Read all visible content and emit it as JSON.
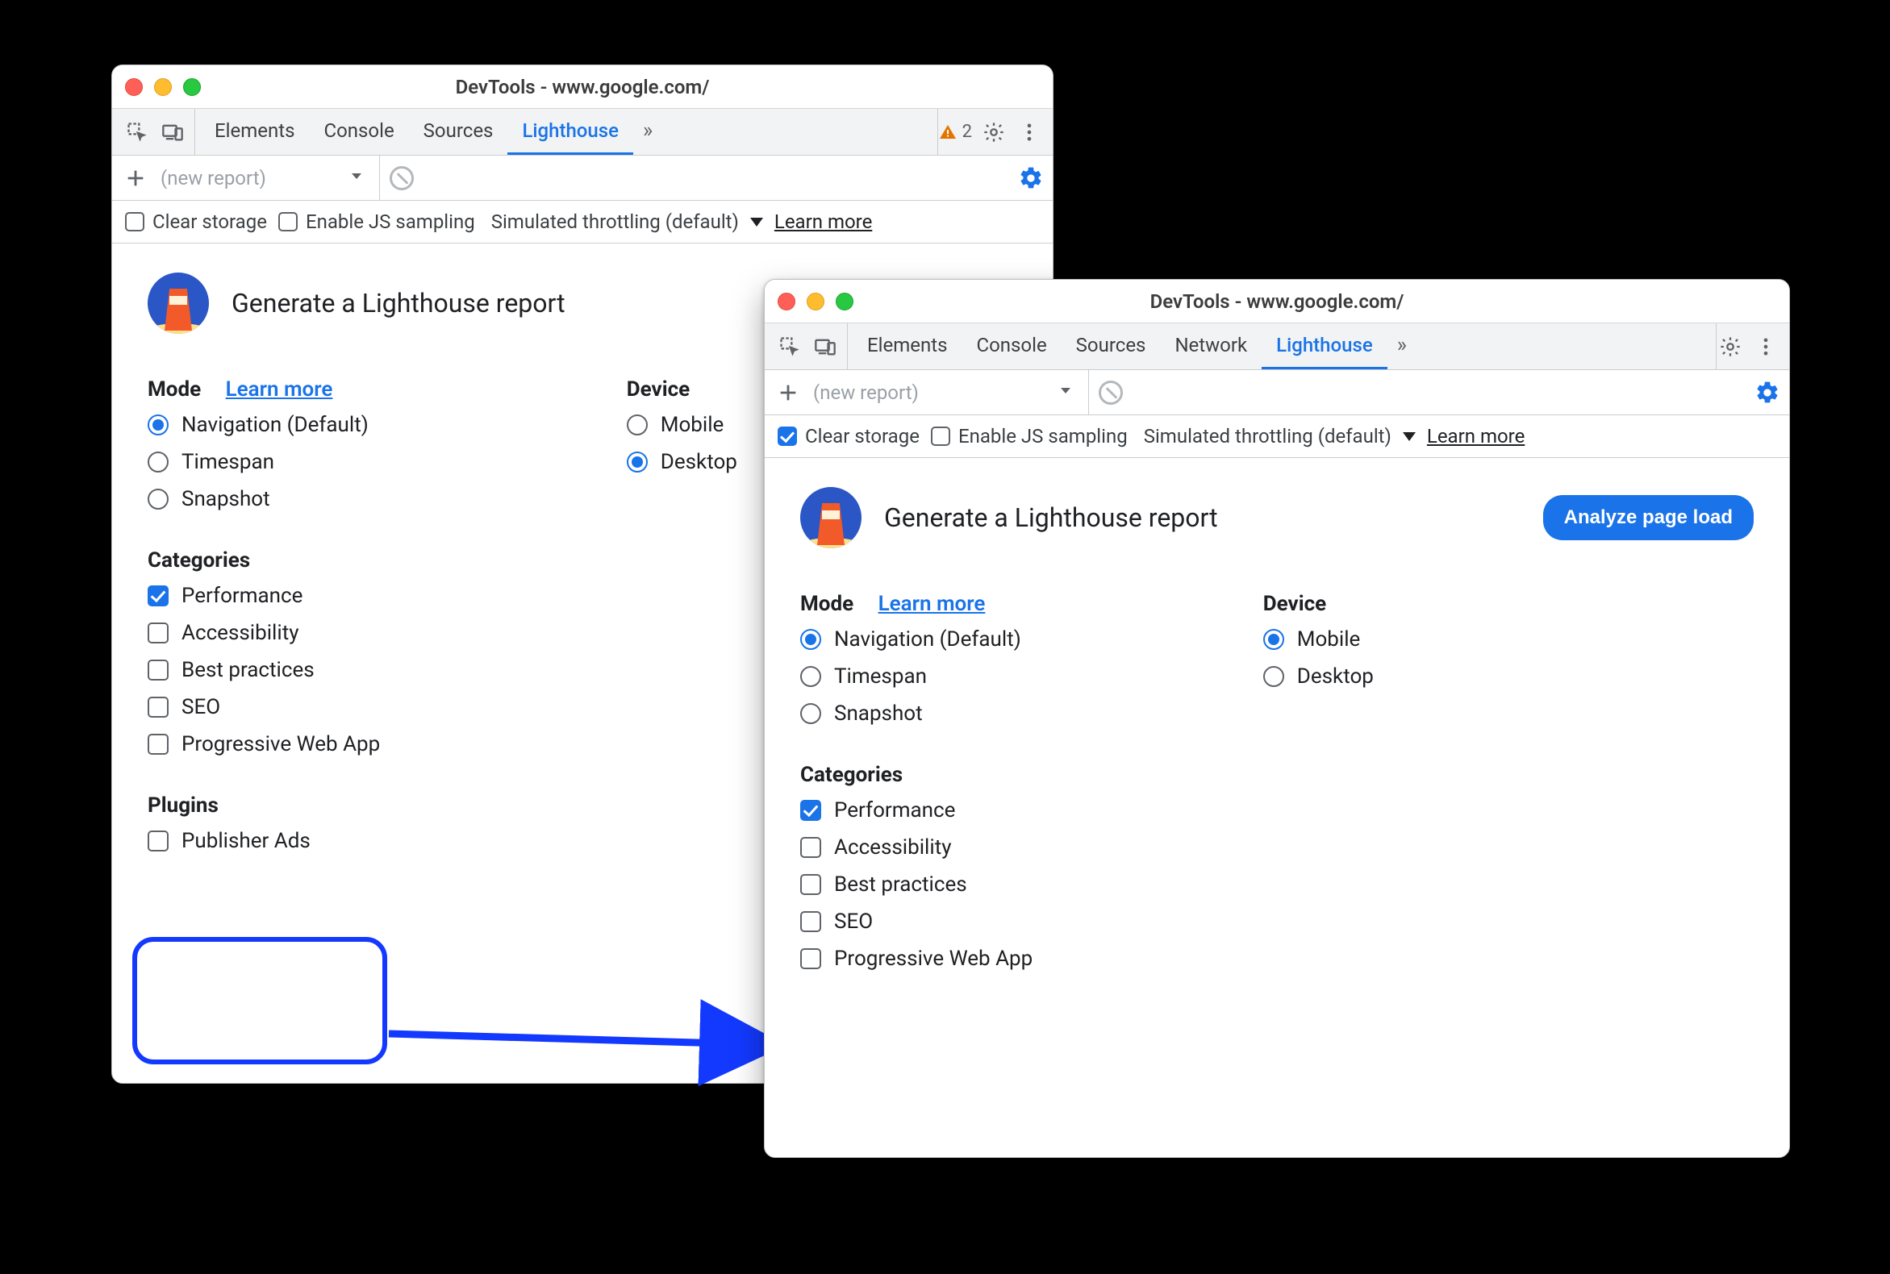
{
  "windowA": {
    "title": "DevTools - www.google.com/",
    "tabs": [
      "Elements",
      "Console",
      "Sources",
      "Lighthouse"
    ],
    "activeTab": "Lighthouse",
    "moreGlyph": "»",
    "warningCount": "2",
    "toolbar2": {
      "newReport": "(new report)",
      "clearStorage": {
        "label": "Clear storage",
        "checked": false
      },
      "enableJsSampling": {
        "label": "Enable JS sampling",
        "checked": false
      },
      "throttling": "Simulated throttling (default)",
      "learnMore": "Learn more"
    },
    "panel": {
      "heading": "Generate a Lighthouse report",
      "mode": {
        "title": "Mode",
        "learnMore": "Learn more",
        "options": [
          {
            "label": "Navigation (Default)",
            "selected": true
          },
          {
            "label": "Timespan",
            "selected": false
          },
          {
            "label": "Snapshot",
            "selected": false
          }
        ]
      },
      "device": {
        "title": "Device",
        "options": [
          {
            "label": "Mobile",
            "selected": false
          },
          {
            "label": "Desktop",
            "selected": true
          }
        ]
      },
      "categories": {
        "title": "Categories",
        "options": [
          {
            "label": "Performance",
            "selected": true
          },
          {
            "label": "Accessibility",
            "selected": false
          },
          {
            "label": "Best practices",
            "selected": false
          },
          {
            "label": "SEO",
            "selected": false
          },
          {
            "label": "Progressive Web App",
            "selected": false
          }
        ]
      },
      "plugins": {
        "title": "Plugins",
        "options": [
          {
            "label": "Publisher Ads",
            "selected": false
          }
        ]
      }
    }
  },
  "windowB": {
    "title": "DevTools - www.google.com/",
    "tabs": [
      "Elements",
      "Console",
      "Sources",
      "Network",
      "Lighthouse"
    ],
    "activeTab": "Lighthouse",
    "moreGlyph": "»",
    "toolbar2": {
      "newReport": "(new report)",
      "clearStorage": {
        "label": "Clear storage",
        "checked": true
      },
      "enableJsSampling": {
        "label": "Enable JS sampling",
        "checked": false
      },
      "throttling": "Simulated throttling (default)",
      "learnMore": "Learn more"
    },
    "panel": {
      "heading": "Generate a Lighthouse report",
      "cta": "Analyze page load",
      "mode": {
        "title": "Mode",
        "learnMore": "Learn more",
        "options": [
          {
            "label": "Navigation (Default)",
            "selected": true
          },
          {
            "label": "Timespan",
            "selected": false
          },
          {
            "label": "Snapshot",
            "selected": false
          }
        ]
      },
      "device": {
        "title": "Device",
        "options": [
          {
            "label": "Mobile",
            "selected": true
          },
          {
            "label": "Desktop",
            "selected": false
          }
        ]
      },
      "categories": {
        "title": "Categories",
        "options": [
          {
            "label": "Performance",
            "selected": true
          },
          {
            "label": "Accessibility",
            "selected": false
          },
          {
            "label": "Best practices",
            "selected": false
          },
          {
            "label": "SEO",
            "selected": false
          },
          {
            "label": "Progressive Web App",
            "selected": false
          }
        ]
      }
    }
  }
}
